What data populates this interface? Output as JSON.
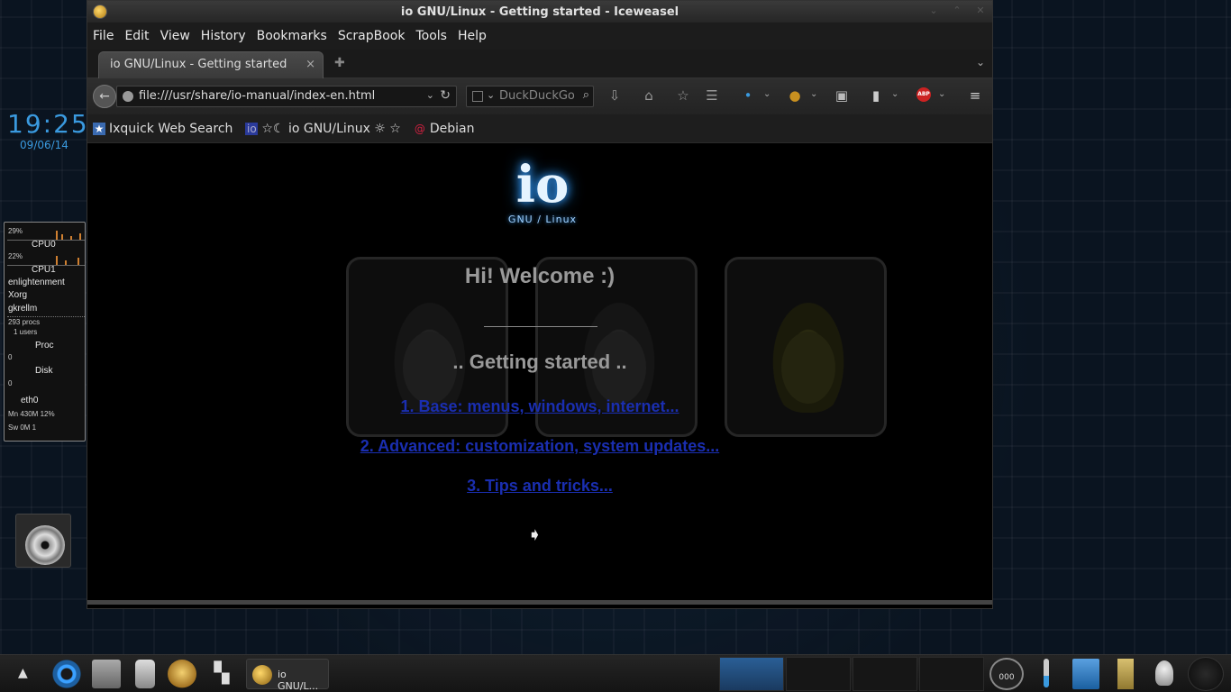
{
  "desktop": {
    "clock_time": "19:25",
    "clock_date": "09/06/14"
  },
  "gkrellm": {
    "cpu0_pct": "29%",
    "cpu0_label": "CPU0",
    "cpu1_pct": "22%",
    "cpu1_label": "CPU1",
    "proc1": "enlightenment",
    "proc2": "Xorg",
    "proc3": "gkrellm",
    "procs": "293 procs",
    "users": "1 users",
    "proc_label": "Proc",
    "proc_val": "0",
    "disk_label": "Disk",
    "disk_val": "0",
    "net_label": "eth0",
    "mem": "Mn 430M 12%",
    "swap": "Sw  0M 1"
  },
  "window": {
    "title": "io GNU/Linux - Getting started - Iceweasel"
  },
  "menu": [
    "File",
    "Edit",
    "View",
    "History",
    "Bookmarks",
    "ScrapBook",
    "Tools",
    "Help"
  ],
  "tab": {
    "label": "io GNU/Linux - Getting started",
    "close": "×"
  },
  "nav": {
    "url": "file:///usr/share/io-manual/index-en.html",
    "search_placeholder": "DuckDuckGo"
  },
  "bookmarks": [
    {
      "label": "Ixquick Web Search",
      "icon": "star-icon"
    },
    {
      "label": "☆☾ io GNU/Linux ☼ ☆",
      "icon": "io-icon"
    },
    {
      "label": "Debian",
      "icon": "debian-swirl-icon"
    }
  ],
  "page": {
    "logo_text": "io",
    "logo_sub": "GNU / Linux",
    "welcome": "Hi! Welcome :)",
    "getting_started": ".. Getting started ..",
    "link1": "1. Base: menus, windows, internet...",
    "link2": "2. Advanced: customization, system updates...",
    "link3": "3. Tips and tricks...",
    "link_color": "#1a2eb0"
  },
  "taskbar": {
    "task_label": "io GNU/L...",
    "gauge_text": "000"
  }
}
